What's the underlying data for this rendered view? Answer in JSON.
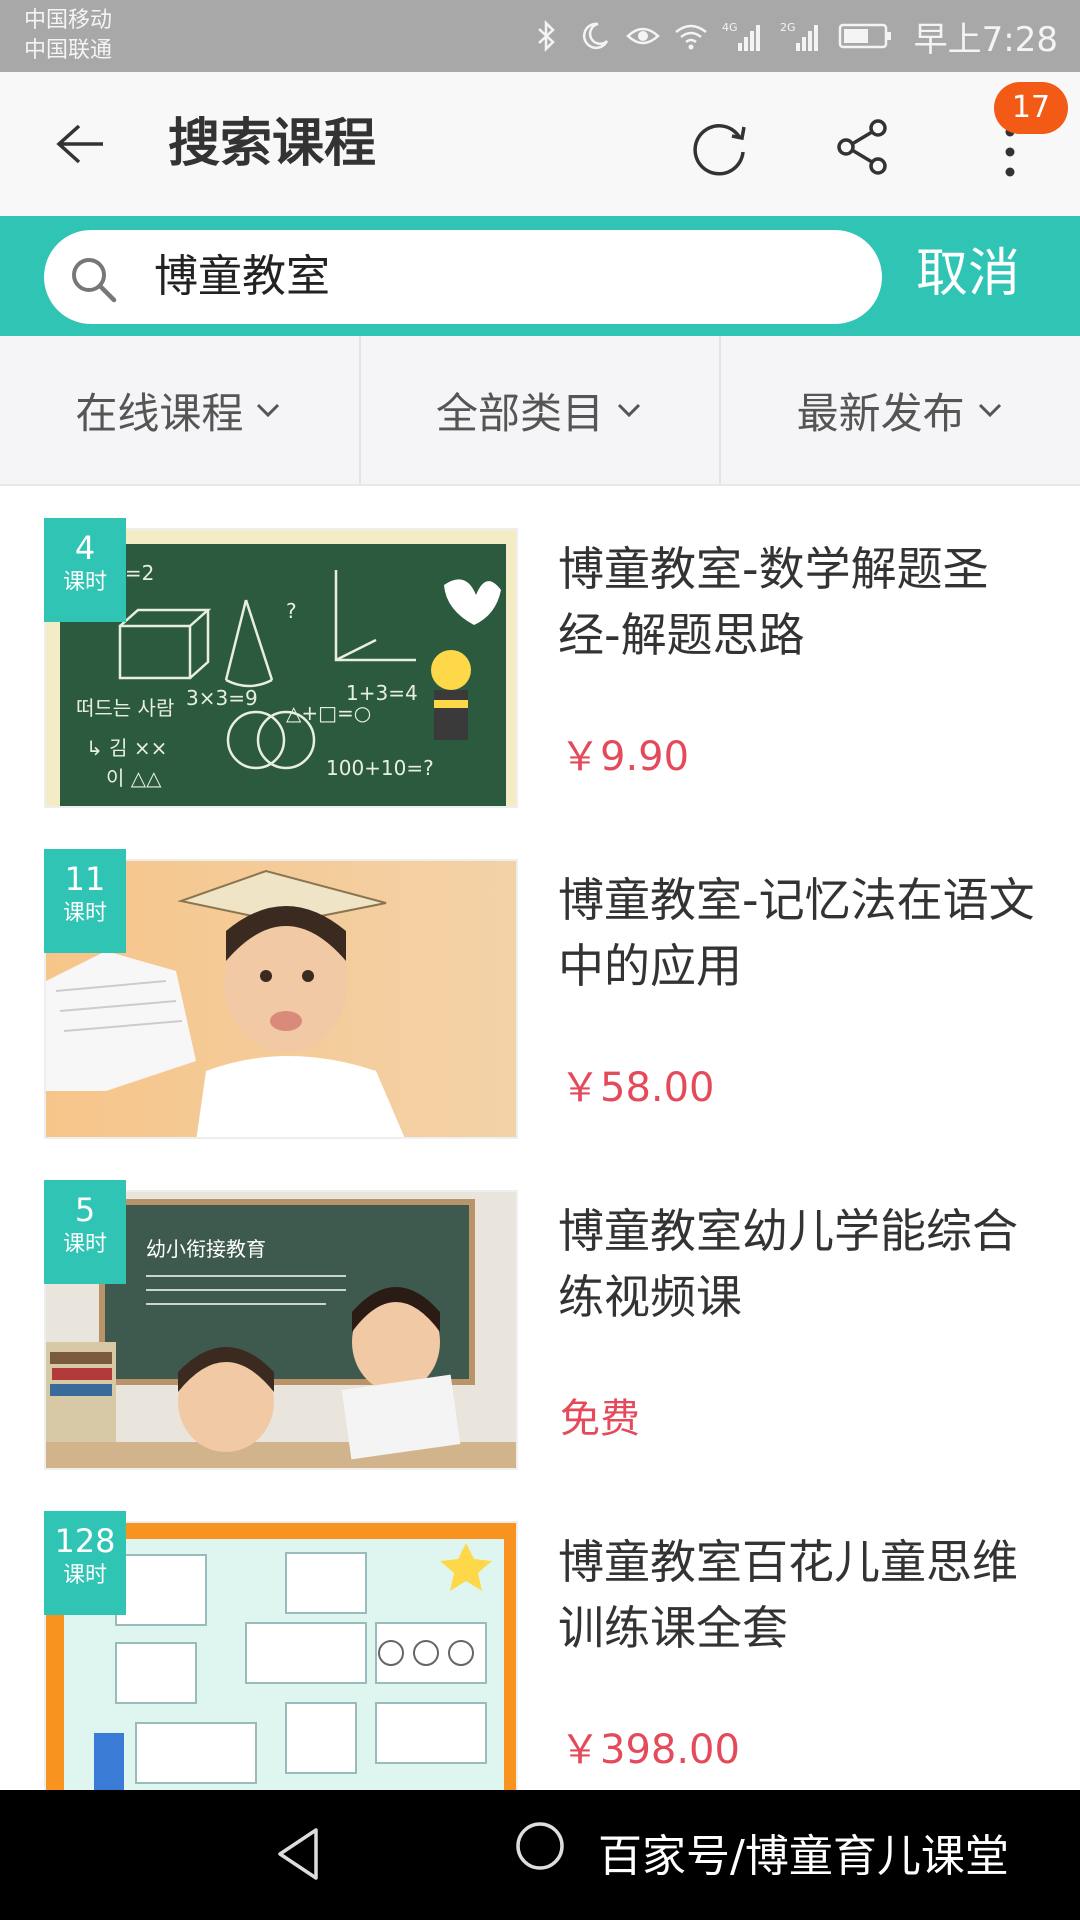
{
  "status_bar": {
    "carrier1": "中国移动",
    "carrier2": "中国联通",
    "net1": "4G",
    "net2": "2G",
    "time": "早上7:28"
  },
  "header": {
    "title": "搜索课程",
    "badge": "17"
  },
  "search": {
    "value": "博童教室",
    "cancel": "取消"
  },
  "filters": [
    {
      "label": "在线课程"
    },
    {
      "label": "全部类目"
    },
    {
      "label": "最新发布"
    }
  ],
  "courses": [
    {
      "lessons": "4",
      "unit": "课时",
      "title": "博童教室-数学解题圣经-解题思路",
      "price": "￥9.90",
      "theme": "chalkboard"
    },
    {
      "lessons": "11",
      "unit": "课时",
      "title": "博童教室-记忆法在语文中的应用",
      "price": "￥58.00",
      "theme": "boy-book"
    },
    {
      "lessons": "5",
      "unit": "课时",
      "title": "博童教室幼儿学能综合练视频课",
      "price": "免费",
      "theme": "kids-classroom",
      "board_text": "幼小衔接教育"
    },
    {
      "lessons": "128",
      "unit": "课时",
      "title": "博童教室百花儿童思维训练课全套",
      "price": "￥398.00",
      "theme": "worksheet"
    }
  ],
  "navbar": {
    "watermark": "百家号/博童育儿课堂"
  },
  "colors": {
    "accent": "#2fc4b4",
    "price": "#e54a5a",
    "badge": "#f25a16"
  }
}
